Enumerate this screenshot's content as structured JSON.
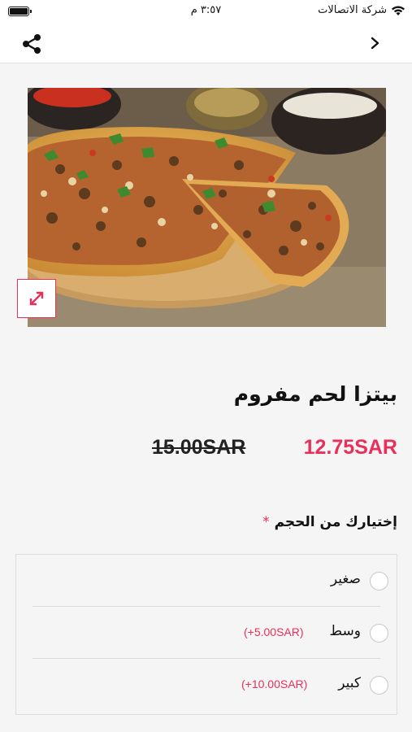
{
  "status_bar": {
    "carrier": "شركة الاتصالات",
    "time": "٣:٥٧ م",
    "battery_level": 1.0
  },
  "nav": {
    "share_icon": "share-icon",
    "back_icon": "chevron-right-icon"
  },
  "product": {
    "title": "بيتزا لحم مفروم",
    "price_current": "12.75SAR",
    "price_old": "15.00SAR",
    "expand_icon": "expand-icon"
  },
  "size": {
    "title": "إختيارك من الحجم",
    "required_mark": "*",
    "options": [
      {
        "label": "صغير",
        "extra": "",
        "selected": false
      },
      {
        "label": "وسط",
        "extra": "(+5.00SAR)",
        "selected": false
      },
      {
        "label": "كبير",
        "extra": "(+10.00SAR)",
        "selected": false
      }
    ]
  },
  "colors": {
    "accent": "#e8305a",
    "background": "#f5f5f5"
  }
}
